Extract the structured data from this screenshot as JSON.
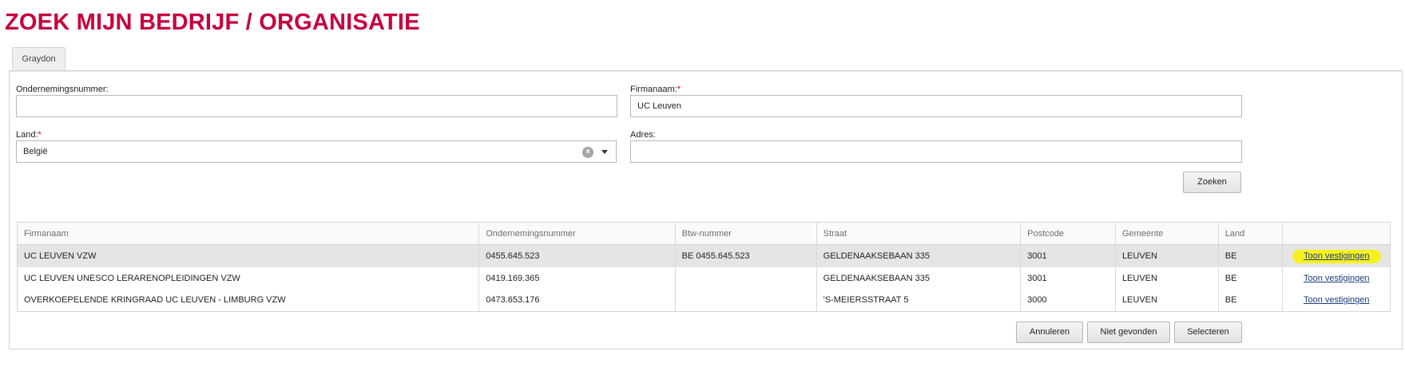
{
  "page": {
    "title": "ZOEK MIJN BEDRIJF / ORGANISATIE",
    "tab_label": "Graydon"
  },
  "form": {
    "ondernemingsnummer": {
      "label": "Ondernemingsnummer:",
      "value": ""
    },
    "firmanaam": {
      "label": "Firmanaam:",
      "required_mark": "*",
      "value": "UC Leuven"
    },
    "land": {
      "label": "Land:",
      "required_mark": "*",
      "value": "België"
    },
    "adres": {
      "label": "Adres:",
      "value": ""
    },
    "search_button": "Zoeken"
  },
  "results": {
    "headers": [
      "Firmanaam",
      "Ondernemingsnummer",
      "Btw-nummer",
      "Straat",
      "Postcode",
      "Gemeente",
      "Land",
      ""
    ],
    "rows": [
      {
        "firmanaam": "UC LEUVEN VZW",
        "ondernemingsnummer": "0455.645.523",
        "btw": "BE 0455.645.523",
        "straat": "GELDENAAKSEBAAN 335",
        "postcode": "3001",
        "gemeente": "LEUVEN",
        "land": "BE",
        "action": "Toon vestigingen",
        "selected": true
      },
      {
        "firmanaam": "UC LEUVEN UNESCO LERARENOPLEIDINGEN VZW",
        "ondernemingsnummer": "0419.169.365",
        "btw": "",
        "straat": "GELDENAAKSEBAAN 335",
        "postcode": "3001",
        "gemeente": "LEUVEN",
        "land": "BE",
        "action": "Toon vestigingen",
        "selected": false
      },
      {
        "firmanaam": "OVERKOEPELENDE KRINGRAAD UC LEUVEN - LIMBURG VZW",
        "ondernemingsnummer": "0473.653.176",
        "btw": "",
        "straat": "'S-MEIERSSTRAAT 5",
        "postcode": "3000",
        "gemeente": "LEUVEN",
        "land": "BE",
        "action": "Toon vestigingen",
        "selected": false
      }
    ]
  },
  "footer": {
    "cancel_button": "Annuleren",
    "not_found_button": "Niet gevonden",
    "select_button": "Selecteren"
  },
  "colors": {
    "brand": "#c8003c",
    "highlight": "#f7f020",
    "link": "#1a3d7c",
    "selected_row": "#e5e5e5"
  },
  "icons": {
    "clear": "clear-icon",
    "dropdown": "chevron-down-icon"
  }
}
